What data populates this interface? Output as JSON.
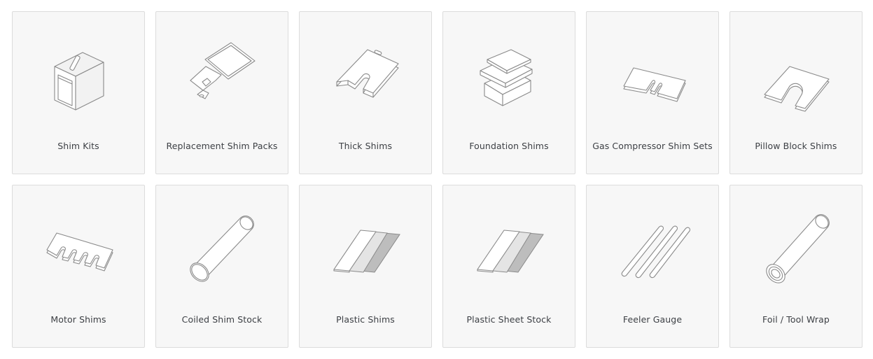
{
  "products": [
    {
      "label": "Shim Kits",
      "icon": "shim-kit-box-icon"
    },
    {
      "label": "Replacement Shim Packs",
      "icon": "shim-pack-icon"
    },
    {
      "label": "Thick Shims",
      "icon": "thick-shim-icon"
    },
    {
      "label": "Foundation Shims",
      "icon": "foundation-shim-icon"
    },
    {
      "label": "Gas Compressor Shim Sets",
      "icon": "compressor-shim-icon"
    },
    {
      "label": "Pillow Block Shims",
      "icon": "pillow-block-shim-icon"
    },
    {
      "label": "Motor Shims",
      "icon": "motor-shim-icon"
    },
    {
      "label": "Coiled Shim Stock",
      "icon": "coiled-stock-icon"
    },
    {
      "label": "Plastic Shims",
      "icon": "plastic-shims-icon"
    },
    {
      "label": "Plastic Sheet Stock",
      "icon": "plastic-sheet-icon"
    },
    {
      "label": "Feeler Gauge",
      "icon": "feeler-gauge-icon"
    },
    {
      "label": "Foil / Tool Wrap",
      "icon": "foil-roll-icon"
    }
  ]
}
